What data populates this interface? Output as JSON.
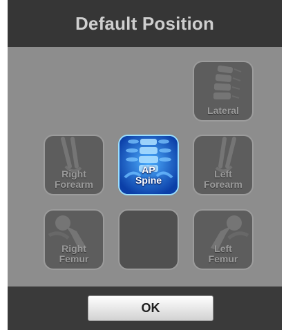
{
  "dialog": {
    "title": "Default Position"
  },
  "tiles": [
    {
      "id": "lateral",
      "label": "Lateral",
      "icon": "lateral-spine-xray-icon",
      "selected": false
    },
    {
      "id": "right-forearm",
      "label": "Right\nForearm",
      "icon": "forearm-xray-icon",
      "selected": false
    },
    {
      "id": "ap-spine",
      "label": "AP\nSpine",
      "icon": "ap-spine-xray-icon",
      "selected": true
    },
    {
      "id": "left-forearm",
      "label": "Left\nForearm",
      "icon": "forearm-xray-icon",
      "selected": false
    },
    {
      "id": "right-femur",
      "label": "Right\nFemur",
      "icon": "femur-xray-icon",
      "selected": false
    },
    {
      "id": "empty",
      "label": "",
      "icon": "",
      "selected": false
    },
    {
      "id": "left-femur",
      "label": "Left\nFemur",
      "icon": "femur-xray-icon",
      "selected": false
    }
  ],
  "footer": {
    "ok_label": "OK"
  },
  "colors": {
    "title_bar": "#363636",
    "panel": "#8d8d8d",
    "tile": "#5d5d5d",
    "selected_tile": "#0b3fa8",
    "selected_border": "#9adfff"
  }
}
